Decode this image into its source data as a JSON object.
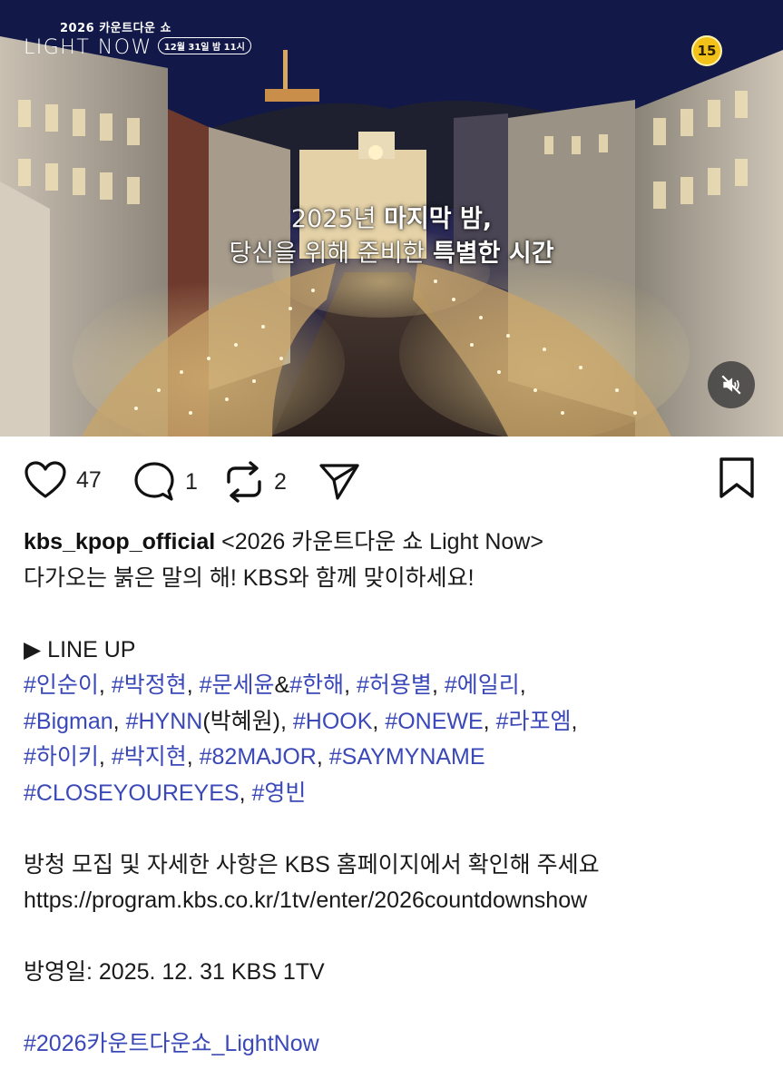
{
  "video": {
    "logo_top": "2026 카운트다운 쇼",
    "logo_main": "LIGHT NOW",
    "logo_date": "12월 31일 밤 11시",
    "age_rating": "15",
    "caption_line1_a": "2025년",
    "caption_line1_b": "마지막 밤,",
    "caption_line2_a": "당신을 위해 준비한",
    "caption_line2_b": "특별한 시간",
    "mute_icon": "muted-speaker-icon"
  },
  "actions": {
    "likes": "47",
    "comments": "1",
    "reposts": "2",
    "icons": [
      "heart-icon",
      "comment-icon",
      "repost-icon",
      "send-icon",
      "bookmark-icon"
    ]
  },
  "post": {
    "username": "kbs_kpop_official",
    "title": "<2026 카운트다운 쇼 Light Now>",
    "intro": "다가오는 붉은 말의 해! KBS와 함께 맞이하세요!",
    "lineup_header": "▶ LINE UP",
    "lineup_line1": [
      {
        "t": "#인순이",
        "tag": true
      },
      {
        "t": ", ",
        "tag": false
      },
      {
        "t": "#박정현",
        "tag": true
      },
      {
        "t": ", ",
        "tag": false
      },
      {
        "t": "#문세윤",
        "tag": true
      },
      {
        "t": "&",
        "tag": false
      },
      {
        "t": "#한해",
        "tag": true
      },
      {
        "t": ", ",
        "tag": false
      },
      {
        "t": "#허용별",
        "tag": true
      },
      {
        "t": ", ",
        "tag": false
      },
      {
        "t": "#에일리",
        "tag": true
      },
      {
        "t": ",",
        "tag": false
      }
    ],
    "lineup_line2": [
      {
        "t": "#Bigman",
        "tag": true
      },
      {
        "t": ", ",
        "tag": false
      },
      {
        "t": "#HYNN",
        "tag": true
      },
      {
        "t": "(박혜원), ",
        "tag": false
      },
      {
        "t": "#HOOK",
        "tag": true
      },
      {
        "t": ", ",
        "tag": false
      },
      {
        "t": "#ONEWE",
        "tag": true
      },
      {
        "t": ", ",
        "tag": false
      },
      {
        "t": "#라포엠",
        "tag": true
      },
      {
        "t": ",",
        "tag": false
      }
    ],
    "lineup_line3": [
      {
        "t": "#하이키",
        "tag": true
      },
      {
        "t": ", ",
        "tag": false
      },
      {
        "t": "#박지현",
        "tag": true
      },
      {
        "t": ", ",
        "tag": false
      },
      {
        "t": "#82MAJOR",
        "tag": true
      },
      {
        "t": ", ",
        "tag": false
      },
      {
        "t": "#SAYMYNAME",
        "tag": true
      }
    ],
    "lineup_line4": [
      {
        "t": "#CLOSEYOUREYES",
        "tag": true
      },
      {
        "t": ", ",
        "tag": false
      },
      {
        "t": "#영빈",
        "tag": true
      }
    ],
    "apply_text": "방청 모집 및 자세한 사항은 KBS 홈페이지에서 확인해 주세요",
    "url": "https://program.kbs.co.kr/1tv/enter/2026countdownshow",
    "air_date": "방영일: 2025. 12. 31 KBS 1TV",
    "footer_tag": "#2026카운트다운쇼_LightNow"
  },
  "colors": {
    "hashtag": "#3a48b8",
    "age_badge": "#f3c21a"
  }
}
